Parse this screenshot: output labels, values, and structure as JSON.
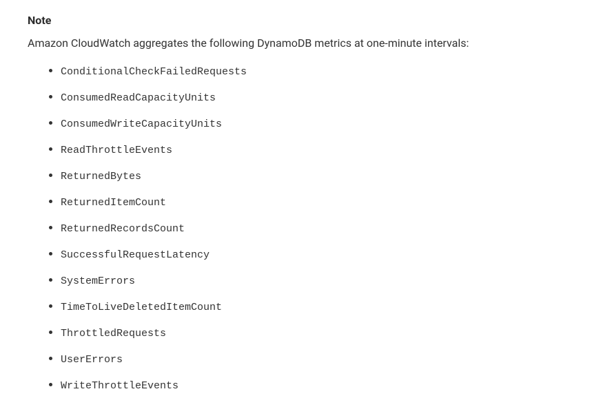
{
  "note": {
    "heading": "Note",
    "intro": "Amazon CloudWatch aggregates the following DynamoDB metrics at one-minute intervals:",
    "metrics": [
      "ConditionalCheckFailedRequests",
      "ConsumedReadCapacityUnits",
      "ConsumedWriteCapacityUnits",
      "ReadThrottleEvents",
      "ReturnedBytes",
      "ReturnedItemCount",
      "ReturnedRecordsCount",
      "SuccessfulRequestLatency",
      "SystemErrors",
      "TimeToLiveDeletedItemCount",
      "ThrottledRequests",
      "UserErrors",
      "WriteThrottleEvents"
    ]
  }
}
